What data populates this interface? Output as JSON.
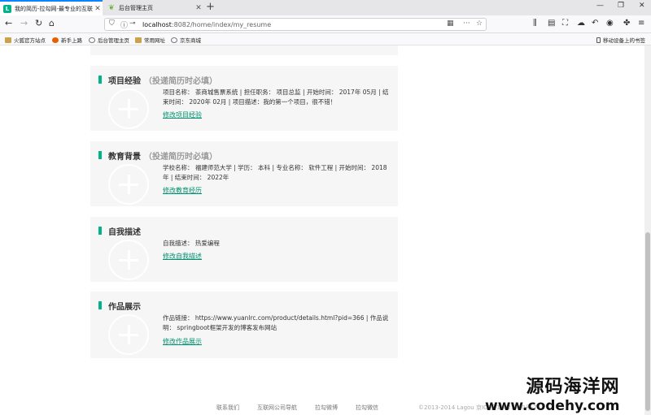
{
  "browser": {
    "tabs": [
      {
        "title": "我的简历-拉勾网-最专业的互联网招聘平台",
        "icon": "lagou-icon",
        "active": true
      },
      {
        "title": "后台管理主页",
        "icon": "spring-leaf-icon",
        "active": false
      }
    ],
    "new_tab_glyph": "+",
    "url_host": "localhost",
    "url_path": ":8082/home/index/my_resume",
    "bookmarks": [
      "火狐官方站点",
      "新手上路",
      "后台管理主页",
      "常用网址",
      "京东商城"
    ],
    "mobile_bookmarks": "移动设备上的书签"
  },
  "resume": {
    "project": {
      "title": "项目经验",
      "note": "（投递简历时必填）",
      "info": "项目名称：  茶商城售票系统 | 担任职务：  项目总监 | 开始时间：  2017年 05月 | 结束时间：  2020年 02月 | 项目描述：我的第一个项目，很不错！",
      "edit": "修改项目经验"
    },
    "education": {
      "title": "教育背景",
      "note": "（投递简历时必填）",
      "info": "学校名称：  福建师范大学 | 学历：  本科 | 专业名称：  软件工程 | 开始时间：  2018年 | 结束时间：  2022年",
      "edit": "修改教育经历"
    },
    "self_desc": {
      "title": "自我描述",
      "info": "自我描述：  热爱编程",
      "edit": "修改自我描述"
    },
    "works": {
      "title": "作品展示",
      "info": "作品链接：  https://www.yuanlrc.com/product/details.html?pid=366 | 作品说明：  springboot框架开发的博客发布网站",
      "edit": "修改作品展示"
    }
  },
  "footer": {
    "links": [
      "联系我们",
      "互联网公司导航",
      "拉勾微博",
      "拉勾微信"
    ],
    "copyright": "©2013-2014 Lagou    京ICP备14023790号-2"
  },
  "watermark": {
    "line1": "源码海洋网",
    "line2": "www.codehy.com"
  },
  "colors": {
    "accent": "#00b38a",
    "link": "#00906f",
    "card_bg": "#f6f6f6"
  }
}
